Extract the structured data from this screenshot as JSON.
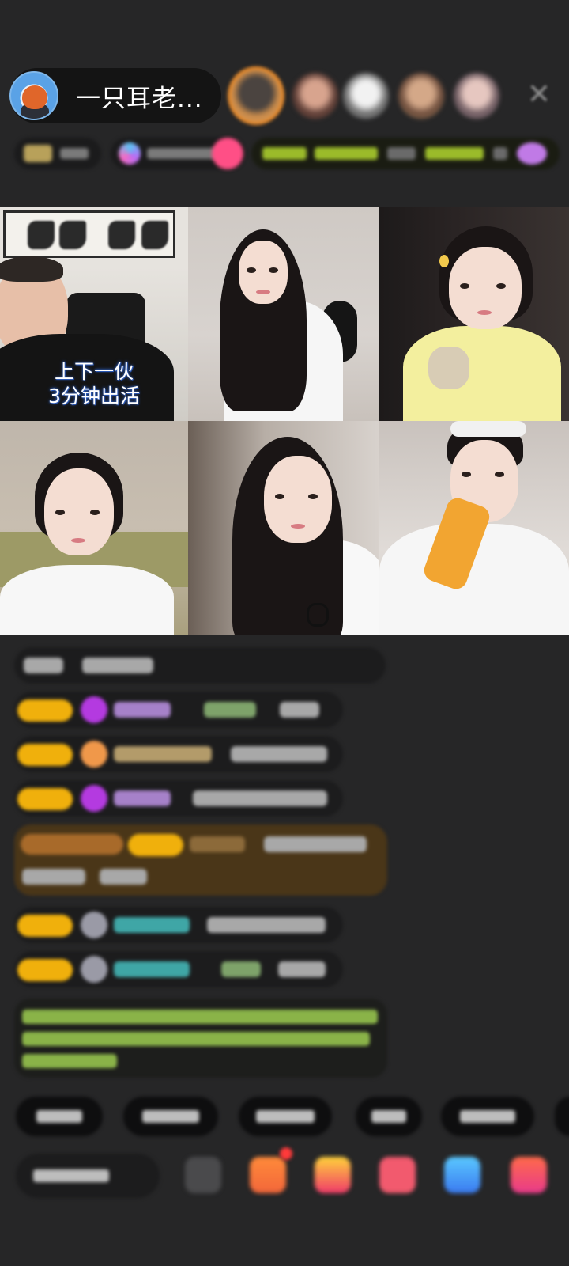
{
  "header": {
    "host_name": "一只耳老...",
    "close_icon": "close-icon"
  },
  "video_grid": {
    "tile_1_caption_line_1": "上下一伙",
    "tile_1_caption_line_2": "3分钟出活"
  },
  "colors": {
    "background": "#262627",
    "level_badge": "#f0b00c",
    "featured_ring": "#e6892a",
    "chat_highlight": "#4a3618"
  }
}
